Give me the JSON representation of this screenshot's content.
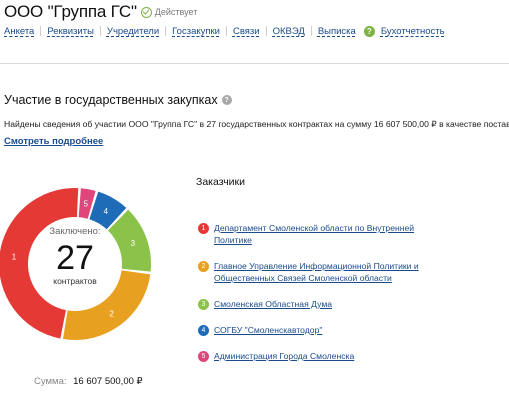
{
  "header": {
    "company_name": "ООО \"Группа ГС\"",
    "status_text": "Действует"
  },
  "nav": {
    "items": [
      "Анкета",
      "Реквизиты",
      "Учредители",
      "Госзакупки",
      "Связи",
      "ОКВЭД",
      "Выписка",
      "Бухотчетность"
    ],
    "help_label": "?"
  },
  "section": {
    "title": "Участие в государственных закупках",
    "help_icon": "?",
    "summary_text": "Найдены сведения об участии ООО \"Группа ГС\" в 27 государственных контрактах на сумму 16 607 500,00 ₽ в качестве поставщика.",
    "more_link": "Смотреть подробнее"
  },
  "chart_center": {
    "label": "Заключено:",
    "count": "27",
    "unit": "контрактов"
  },
  "sum": {
    "label": "Сумма:",
    "value": "16 607 500,00 ₽"
  },
  "customers": {
    "title": "Заказчики",
    "items": [
      {
        "num": "1",
        "name": "Департамент Смоленской области по Внутренней Политике",
        "color": "#e53935"
      },
      {
        "num": "2",
        "name": "Главное Управление Информационной Политики и Общественных Связей Смоленской области",
        "color": "#e8a020"
      },
      {
        "num": "3",
        "name": "Смоленская Областная Дума",
        "color": "#8bc34a"
      },
      {
        "num": "4",
        "name": "СОГБУ \"Смоленскавтодор\"",
        "color": "#1e6bb8"
      },
      {
        "num": "5",
        "name": "Администрация Города Смоленска",
        "color": "#e0457b"
      }
    ]
  },
  "chart_data": {
    "type": "pie",
    "donut": true,
    "categories": [
      "1",
      "2",
      "3",
      "4",
      "5"
    ],
    "values": [
      13,
      7,
      4,
      2,
      1
    ],
    "colors": [
      "#e53935",
      "#e8a020",
      "#8bc34a",
      "#1e6bb8",
      "#e0457b"
    ],
    "title": ""
  }
}
